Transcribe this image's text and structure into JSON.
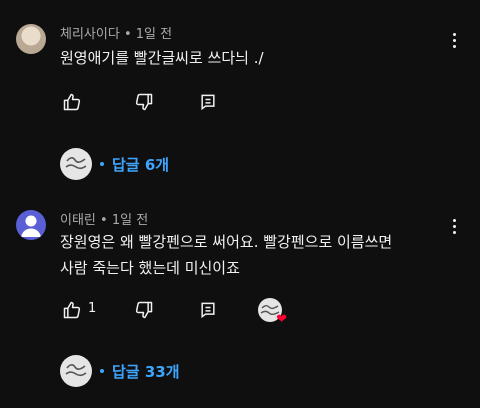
{
  "comments": [
    {
      "author": "체리사이다",
      "separator": "•",
      "time": "1일 전",
      "lines": [
        "원영애기를 빨간글씨로 쓰다늬 ./"
      ],
      "like_count": "",
      "replies_label": "답글 6개",
      "liked_by_creator": false
    },
    {
      "author": "이태린",
      "separator": "•",
      "time": "1일 전",
      "lines": [
        "장원영은 왜 빨강펜으로 써어요. 빨강펜으로 이름쓰면",
        "사람 죽는다 했는데 미신이죠"
      ],
      "like_count": "1",
      "replies_label": "답글 33개",
      "liked_by_creator": true
    }
  ],
  "icons": {
    "like": "thumbs-up-icon",
    "dislike": "thumbs-down-icon",
    "reply": "reply-icon",
    "more": "more-vert-icon",
    "creator_heart": "heart-icon"
  },
  "colors": {
    "background": "#0f0f0f",
    "reply_link": "#3ea6ff",
    "heart": "#ff0033"
  }
}
